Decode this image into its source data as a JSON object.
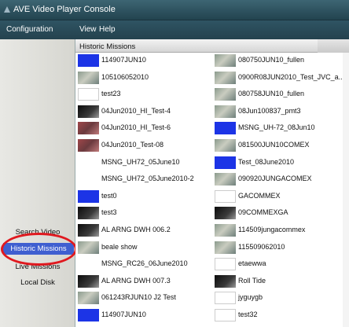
{
  "app": {
    "title": "AVE Video Player Console"
  },
  "menu": {
    "items": [
      "Configuration",
      "View",
      "Help"
    ]
  },
  "sidebar": {
    "items": [
      {
        "label": "Search Video",
        "selected": false
      },
      {
        "label": "Historic Missions",
        "selected": true
      },
      {
        "label": "Live Missions",
        "selected": false
      },
      {
        "label": "Local Disk",
        "selected": false
      }
    ]
  },
  "panel": {
    "title": "Historic Missions"
  },
  "missions": {
    "left": [
      {
        "label": "114907JUN10",
        "thumb": "video-thumb-blue"
      },
      {
        "label": "105106052010",
        "thumb": "video-thumb-aerial"
      },
      {
        "label": "test23",
        "thumb": "video-thumb-blank"
      },
      {
        "label": "04Jun2010_HI_Test-4",
        "thumb": "video-thumb-dark"
      },
      {
        "label": "04Jun2010_HI_Test-6",
        "thumb": "video-thumb-red"
      },
      {
        "label": "04Jun2010_Test-08",
        "thumb": "video-thumb-red"
      },
      {
        "label": "MSNG_UH72_05June10",
        "thumb": "video-thumb-gray"
      },
      {
        "label": "MSNG_UH72_05June2010-2",
        "thumb": "video-thumb-gray"
      },
      {
        "label": "test0",
        "thumb": "video-thumb-blue"
      },
      {
        "label": "test3",
        "thumb": "video-thumb-dark"
      },
      {
        "label": "AL ARNG DWH 006.2",
        "thumb": "video-thumb-dark"
      },
      {
        "label": "beale show",
        "thumb": "video-thumb-aerial"
      },
      {
        "label": "MSNG_RC26_06June2010",
        "thumb": "video-thumb-gray"
      },
      {
        "label": "AL ARNG DWH 007.3",
        "thumb": "video-thumb-dark"
      },
      {
        "label": "061243RJUN10 J2 Test",
        "thumb": "video-thumb-aerial"
      },
      {
        "label": "114907JUN10",
        "thumb": "video-thumb-blue"
      }
    ],
    "right": [
      {
        "label": "080750JUN10_fullen",
        "thumb": "video-thumb-aerial"
      },
      {
        "label": "0900R08JUN2010_Test_JVC_a...",
        "thumb": "video-thumb-aerial"
      },
      {
        "label": "080758JUN10_fullen",
        "thumb": "video-thumb-aerial"
      },
      {
        "label": "08Jun100837_pmt3",
        "thumb": "video-thumb-aerial"
      },
      {
        "label": "MSNG_UH-72_08Jun10",
        "thumb": "video-thumb-blue"
      },
      {
        "label": "081500JUN10COMEX",
        "thumb": "video-thumb-aerial"
      },
      {
        "label": "Test_08June2010",
        "thumb": "video-thumb-blue"
      },
      {
        "label": "090920JUNGACOMEX",
        "thumb": "video-thumb-aerial"
      },
      {
        "label": "GACOMMEX",
        "thumb": "video-thumb-blank"
      },
      {
        "label": "09COMMEXGA",
        "thumb": "video-thumb-dark"
      },
      {
        "label": "114509jungacommex",
        "thumb": "video-thumb-aerial"
      },
      {
        "label": "115509062010",
        "thumb": "video-thumb-aerial"
      },
      {
        "label": "etaewwa",
        "thumb": "video-thumb-blank"
      },
      {
        "label": "Roll Tide",
        "thumb": "video-thumb-dark"
      },
      {
        "label": "jyguygb",
        "thumb": "video-thumb-blank"
      },
      {
        "label": "test32",
        "thumb": "video-thumb-blank"
      }
    ]
  },
  "colors": {
    "accent": "#3f5fd0",
    "highlight_ring": "#e0191f",
    "titlebar": "#2a4a58"
  }
}
